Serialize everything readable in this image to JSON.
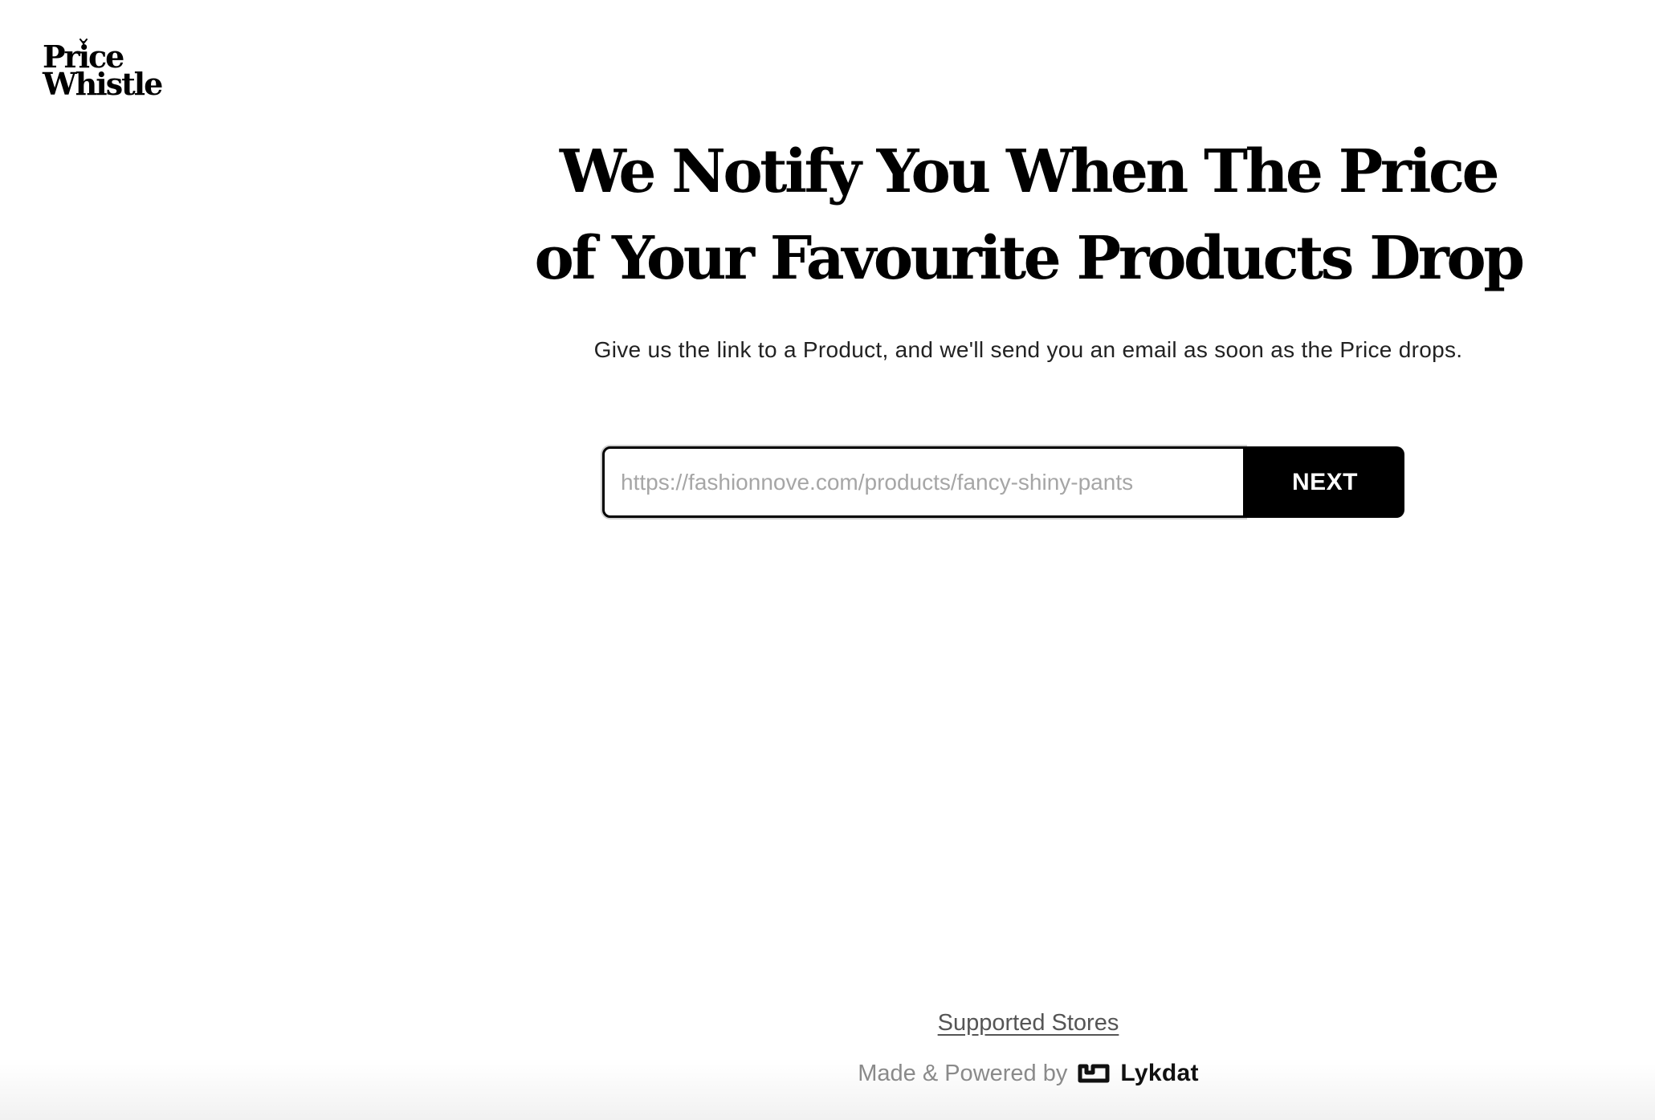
{
  "logo": {
    "line1": "Price",
    "line2": "Whistle",
    "icon": "sprig-icon"
  },
  "hero": {
    "headline_line1": "We Notify You When The Price",
    "headline_line2": "of Your Favourite Products Drop",
    "subtext": "Give us the link to a Product, and we'll send you an email as soon as the Price drops."
  },
  "form": {
    "url_placeholder": "https://fashionnove.com/products/fancy-shiny-pants",
    "url_value": "",
    "next_label": "NEXT"
  },
  "footer": {
    "supported_stores_label": "Supported Stores",
    "powered_prefix": "Made & Powered by",
    "brand_name": "Lykdat",
    "brand_icon": "lykdat-logo-icon"
  },
  "colors": {
    "primary": "#000000",
    "background": "#ffffff",
    "placeholder": "#a6a6a6",
    "muted_text": "#8a8a8a"
  }
}
